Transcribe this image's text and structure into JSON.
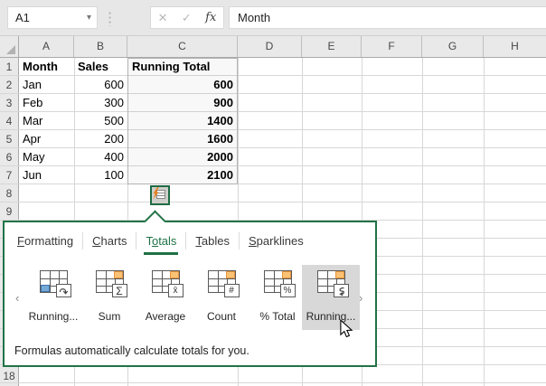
{
  "formula_bar": {
    "name_box": "A1",
    "dropdown_glyph": "▾",
    "cancel_glyph": "✕",
    "enter_glyph": "✓",
    "fx_glyph": "fx",
    "formula": "Month"
  },
  "grid": {
    "columns": [
      "A",
      "B",
      "C",
      "D",
      "E",
      "F",
      "G",
      "H"
    ],
    "row_numbers": [
      "1",
      "2",
      "3",
      "4",
      "5",
      "6",
      "7",
      "8",
      "9"
    ],
    "bottom_row_number": "18"
  },
  "table": {
    "headers": {
      "month": "Month",
      "sales": "Sales",
      "total": "Running Total"
    },
    "rows": [
      {
        "month": "Jan",
        "sales": "600",
        "total": "600"
      },
      {
        "month": "Feb",
        "sales": "300",
        "total": "900"
      },
      {
        "month": "Mar",
        "sales": "500",
        "total": "1400"
      },
      {
        "month": "Apr",
        "sales": "200",
        "total": "1600"
      },
      {
        "month": "May",
        "sales": "400",
        "total": "2000"
      },
      {
        "month": "Jun",
        "sales": "100",
        "total": "2100"
      }
    ]
  },
  "quick_analysis": {
    "button_icon": "quick-analysis-icon",
    "tabs": [
      {
        "pre": "",
        "accel": "F",
        "post": "ormatting"
      },
      {
        "pre": "",
        "accel": "C",
        "post": "harts"
      },
      {
        "pre": "T",
        "accel": "o",
        "post": "tals"
      },
      {
        "pre": "",
        "accel": "T",
        "post": "ables"
      },
      {
        "pre": "",
        "accel": "S",
        "post": "parklines"
      }
    ],
    "active_tab": "Totals",
    "nav_left": "‹",
    "nav_right": "›",
    "items": [
      {
        "label": "Running...",
        "icon": "running-total-rows-icon",
        "symbol": "curve-down-arrow"
      },
      {
        "label": "Sum",
        "icon": "sum-icon",
        "symbol": "Σ"
      },
      {
        "label": "Average",
        "icon": "average-icon",
        "symbol": "x̄"
      },
      {
        "label": "Count",
        "icon": "count-icon",
        "symbol": "#"
      },
      {
        "label": "% Total",
        "icon": "percent-total-icon",
        "symbol": "%"
      },
      {
        "label": "Running...",
        "icon": "running-total-column-icon",
        "symbol": "s-curve-arrow"
      }
    ],
    "footer": "Formulas automatically calculate totals for you."
  },
  "colors": {
    "accent_green": "#217346",
    "orange_cell": "#fbc275",
    "blue_cell": "#74a9d8",
    "header_bg": "#e9e9e9"
  }
}
